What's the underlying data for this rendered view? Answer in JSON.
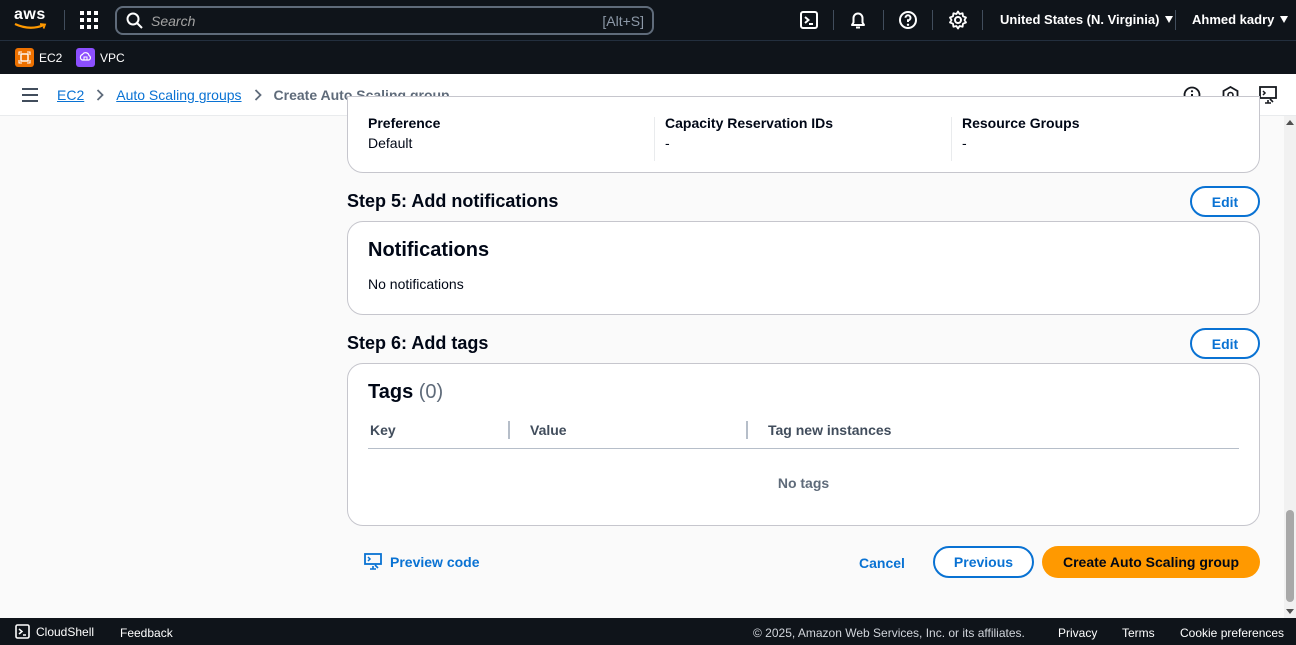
{
  "topbar": {
    "search_placeholder": "Search",
    "search_shortcut": "[Alt+S]",
    "region": "United States (N. Virginia)",
    "user": "Ahmed kadry"
  },
  "favorites": [
    {
      "label": "EC2",
      "color": "#ed7100"
    },
    {
      "label": "VPC",
      "color": "#8c4fff"
    }
  ],
  "breadcrumb": {
    "items": [
      "EC2",
      "Auto Scaling groups"
    ],
    "current": "Create Auto Scaling group"
  },
  "preference_section": {
    "columns": [
      {
        "label": "Preference",
        "value": "Default"
      },
      {
        "label": "Capacity Reservation IDs",
        "value": "-"
      },
      {
        "label": "Resource Groups",
        "value": "-"
      }
    ]
  },
  "step5": {
    "heading": "Step 5: Add notifications",
    "edit_label": "Edit",
    "card_title": "Notifications",
    "card_text": "No notifications"
  },
  "step6": {
    "heading": "Step 6: Add tags",
    "edit_label": "Edit",
    "card_title": "Tags",
    "card_count": "(0)",
    "columns": [
      "Key",
      "Value",
      "Tag new instances"
    ],
    "empty_text": "No tags"
  },
  "actions": {
    "preview_code": "Preview code",
    "cancel": "Cancel",
    "previous": "Previous",
    "create": "Create Auto Scaling group"
  },
  "footer": {
    "cloudshell": "CloudShell",
    "feedback": "Feedback",
    "copyright": "© 2025, Amazon Web Services, Inc. or its affiliates.",
    "privacy": "Privacy",
    "terms": "Terms",
    "cookie": "Cookie preferences"
  },
  "colors": {
    "primary_link": "#0972d3",
    "primary_button": "#ff9900",
    "nav_background": "#0f141a"
  }
}
